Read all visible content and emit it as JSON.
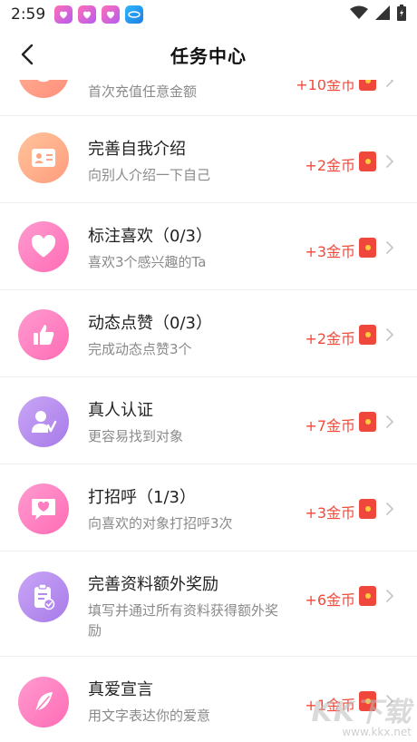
{
  "status_bar": {
    "time": "2:59",
    "apps": [
      "pink-heart-app-icon",
      "pink-heart-app-icon",
      "pink-heart-app-icon",
      "blue-app-icon"
    ],
    "icons": [
      "wifi-icon",
      "signal-icon",
      "battery-charging-icon"
    ]
  },
  "header": {
    "title": "任务中心",
    "back_icon": "back-arrow-icon"
  },
  "tasks": [
    {
      "title": "",
      "desc": "首次充值任意金额",
      "reward": "+10金币",
      "icon": "recharge-icon",
      "color": "#ff9c87"
    },
    {
      "title": "完善自我介绍",
      "desc": "向别人介绍一下自己",
      "reward": "+2金币",
      "icon": "id-card-icon",
      "color": "#ffad86"
    },
    {
      "title": "标注喜欢（0/3）",
      "desc": "喜欢3个感兴趣的Ta",
      "reward": "+3金币",
      "icon": "heart-icon",
      "color": "#ff7cc0"
    },
    {
      "title": "动态点赞（0/3）",
      "desc": "完成动态点赞3个",
      "reward": "+2金币",
      "icon": "thumbs-up-icon",
      "color": "#ff7cc0"
    },
    {
      "title": "真人认证",
      "desc": "更容易找到对象",
      "reward": "+7金币",
      "icon": "verified-user-icon",
      "color": "#b98df2"
    },
    {
      "title": "打招呼（1/3）",
      "desc": "向喜欢的对象打招呼3次",
      "reward": "+3金币",
      "icon": "chat-heart-icon",
      "color": "#ff7cc0"
    },
    {
      "title": "完善资料额外奖励",
      "desc": "填写并通过所有资料获得额外奖励",
      "reward": "+6金币",
      "icon": "clipboard-check-icon",
      "color": "#b98df2"
    },
    {
      "title": "真爱宣言",
      "desc": "用文字表达你的爱意",
      "reward": "+1金币",
      "icon": "feather-icon",
      "color": "#ff7cc0"
    }
  ],
  "watermark": {
    "main": "KK下载",
    "sub": "www.kkx.net"
  },
  "colors": {
    "reward": "#f24a3b",
    "red_packet": "#f0473c",
    "desc_text": "#8a8a8a"
  }
}
